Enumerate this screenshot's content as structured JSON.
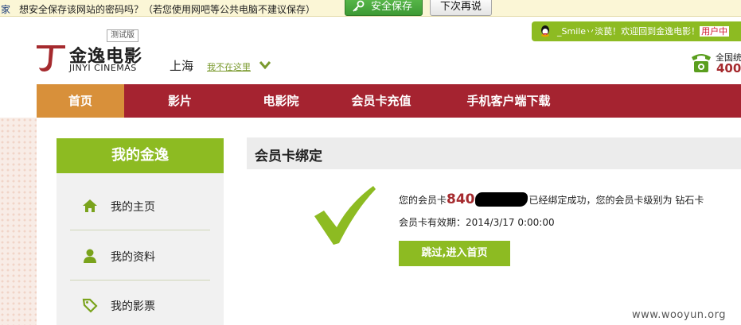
{
  "password_bar": {
    "tail_text": "家",
    "message": "想安全保存该网站的密码吗？（若您使用网吧等公共电脑不建议保存）",
    "save_label": "安全保存",
    "later_label": "下次再说",
    "save_color": "#4aa83e"
  },
  "header": {
    "logo_cn": "金逸电影",
    "logo_en": "JINYI CINEMAS",
    "beta_badge": "测试版",
    "city": "上海",
    "city_switch": "我不在这里",
    "user_bar": {
      "greeting": "_Smile丷淡苠！欢迎回到金逸电影！",
      "center_link": "用户中"
    },
    "hotline": {
      "label": "全国统",
      "number": "400-"
    }
  },
  "nav": {
    "items": [
      {
        "label": "首页",
        "active": true
      },
      {
        "label": "影片",
        "active": false
      },
      {
        "label": "电影院",
        "active": false
      },
      {
        "label": "会员卡充值",
        "active": false
      },
      {
        "label": "手机客户端下载",
        "active": false
      }
    ],
    "bar_color": "#a52330",
    "active_color": "#d8903a"
  },
  "sidebar": {
    "title": "我的金逸",
    "items": [
      {
        "label": "我的主页",
        "icon": "home-icon"
      },
      {
        "label": "我的资料",
        "icon": "user-icon"
      },
      {
        "label": "我的影票",
        "icon": "ticket-tag-icon"
      }
    ],
    "accent_color": "#8dbb22"
  },
  "main": {
    "title": "会员卡绑定",
    "success": {
      "prefix": "您的会员卡",
      "card_no_visible": "840",
      "suffix": "已经绑定成功，您的会员卡级别为 钻石卡",
      "expiry_label": "会员卡有效期：",
      "expiry_value": "2014/3/17 0:00:00"
    },
    "button_label": "跳过,进入首页"
  },
  "watermark": "www.wooyun.org"
}
